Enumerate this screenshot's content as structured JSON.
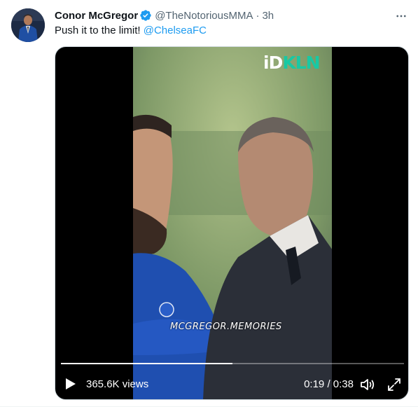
{
  "author": {
    "name": "Conor McGregor",
    "handle": "@TheNotoriousMMA",
    "separator": "·",
    "time": "3h",
    "verified": true
  },
  "tweet": {
    "text": "Push it to the limit!",
    "mention": "@ChelseaFC"
  },
  "video": {
    "brand_left": "iD",
    "brand_right": "KLN",
    "watermark": "MCGREGOR.MEMORIES",
    "views": "365.6K views",
    "elapsed": "0:19",
    "duration": "0:38",
    "time_separator": " / ",
    "progress": 0.5
  },
  "icons": {
    "verified": "verified-badge-icon",
    "more": "more-options-icon",
    "play": "play-icon",
    "volume": "volume-icon",
    "fullscreen": "fullscreen-icon"
  },
  "colors": {
    "link": "#1d9bf0",
    "verified": "#1d9bf0",
    "secondary_text": "#536471",
    "brand_accent": "#18c9a4"
  }
}
